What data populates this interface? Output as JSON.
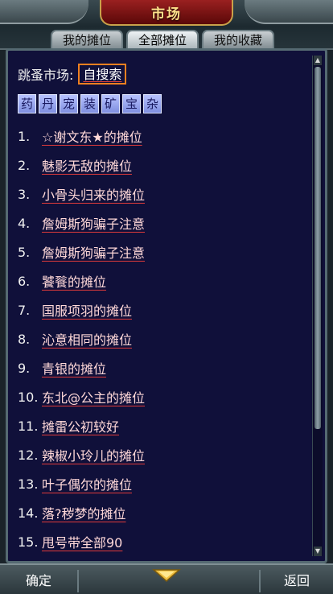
{
  "header": {
    "title": "市场"
  },
  "tabs": [
    {
      "label": "我的摊位",
      "active": false
    },
    {
      "label": "全部摊位",
      "active": true
    },
    {
      "label": "我的收藏",
      "active": false
    }
  ],
  "search": {
    "label": "跳蚤市场:",
    "button": "自搜索"
  },
  "categories": [
    "药",
    "丹",
    "宠",
    "装",
    "矿",
    "宝",
    "杂"
  ],
  "stalls": [
    {
      "num": "1.",
      "name": "☆谢文东★的摊位"
    },
    {
      "num": "2.",
      "name": "魅影无敌的摊位"
    },
    {
      "num": "3.",
      "name": "小骨头归来的摊位"
    },
    {
      "num": "4.",
      "name": "詹姆斯狗骗子注意"
    },
    {
      "num": "5.",
      "name": "詹姆斯狗骗子注意"
    },
    {
      "num": "6.",
      "name": "饕餮的摊位"
    },
    {
      "num": "7.",
      "name": "国服项羽的摊位"
    },
    {
      "num": "8.",
      "name": "沁意相同的摊位"
    },
    {
      "num": "9.",
      "name": "青银的摊位"
    },
    {
      "num": "10.",
      "name": "东北@公主的摊位"
    },
    {
      "num": "11.",
      "name": "摊雷公初较好"
    },
    {
      "num": "12.",
      "name": "辣椒小玲儿的摊位"
    },
    {
      "num": "13.",
      "name": "叶子偶尔的摊位"
    },
    {
      "num": "14.",
      "name": "落?秽梦的摊位"
    },
    {
      "num": "15.",
      "name": "甩号带全部90"
    }
  ],
  "footer": {
    "confirm": "确定",
    "back": "返回"
  },
  "colors": {
    "panel_bg": "#10103a",
    "link": "#ffd8d8",
    "underline": "#e03a3a",
    "title": "#ffe08a"
  }
}
